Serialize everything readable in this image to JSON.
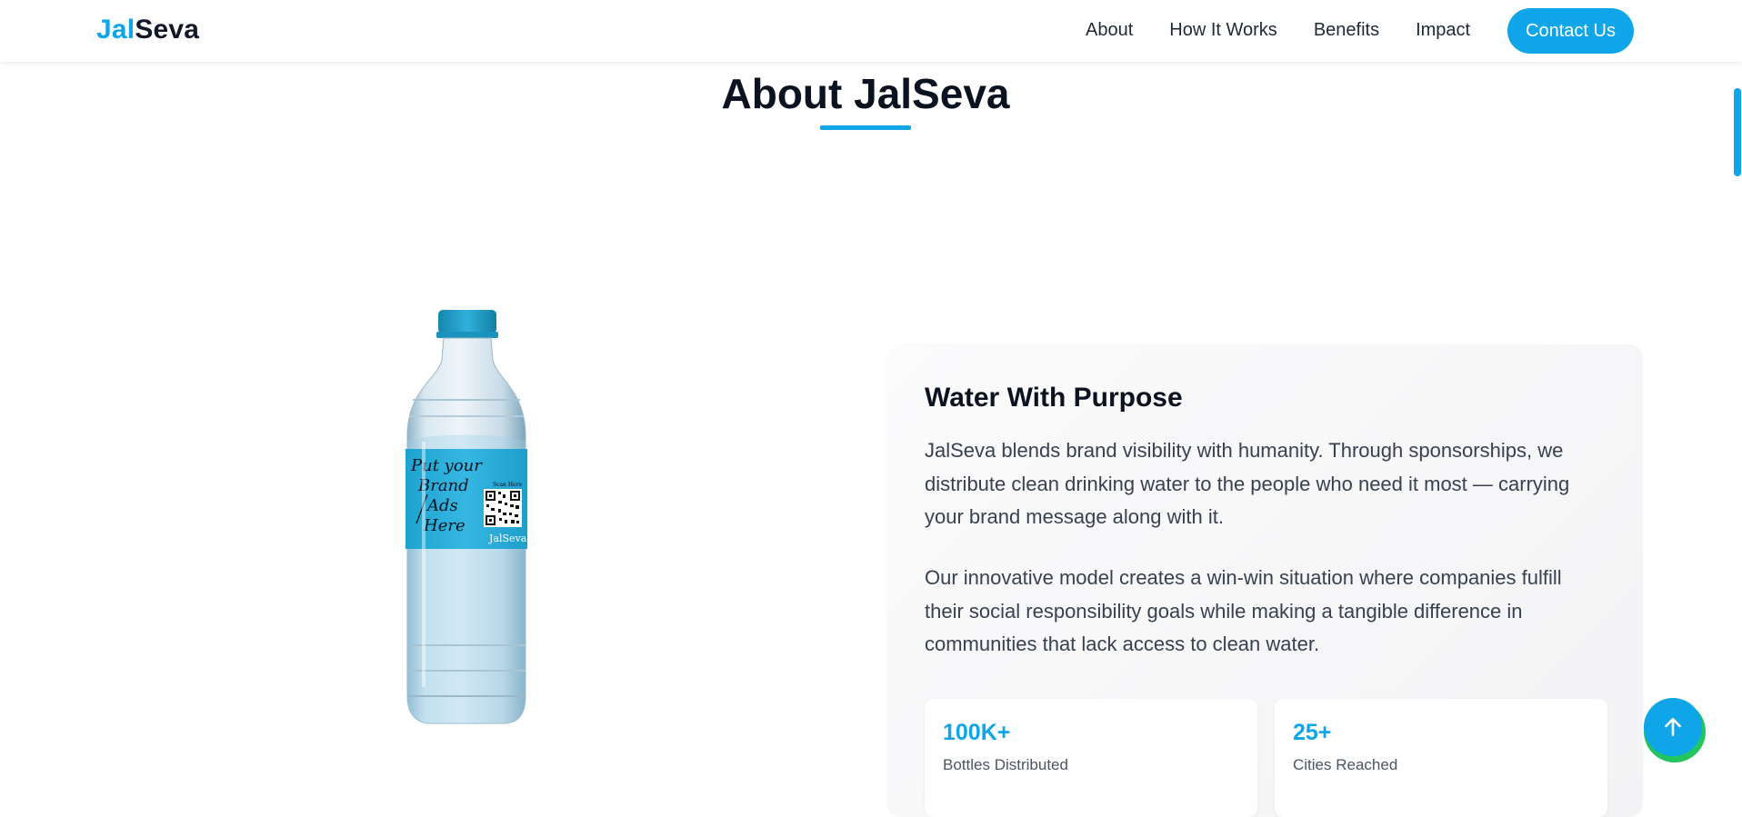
{
  "brand": {
    "part1": "Jal",
    "part2": "Seva"
  },
  "nav": {
    "links": [
      "About",
      "How It Works",
      "Benefits",
      "Impact"
    ],
    "cta": "Contact Us"
  },
  "about": {
    "title": "About JalSeva",
    "card_title": "Water With Purpose",
    "paragraphs": [
      "JalSeva blends brand visibility with humanity. Through sponsorships, we distribute clean drinking water to the people who need it most — carrying your brand message along with it.",
      "Our innovative model creates a win-win situation where companies fulfill their social responsibility goals while making a tangible difference in communities that lack access to clean water."
    ],
    "stats": [
      {
        "value": "100K+",
        "label": "Bottles Distributed"
      },
      {
        "value": "25+",
        "label": "Cities Reached"
      }
    ]
  },
  "bottle": {
    "label_line1": "Put your",
    "label_line2": "Brand",
    "label_line3": "Ads",
    "label_line4": "Here",
    "qr_caption": "Scan Here",
    "label_brand": "JalSeva"
  },
  "icons": {
    "scroll_top": "arrow-up-icon"
  },
  "colors": {
    "accent": "#0ea5e9",
    "fab_shadow": "#22c55e",
    "heading": "#0b1220"
  }
}
